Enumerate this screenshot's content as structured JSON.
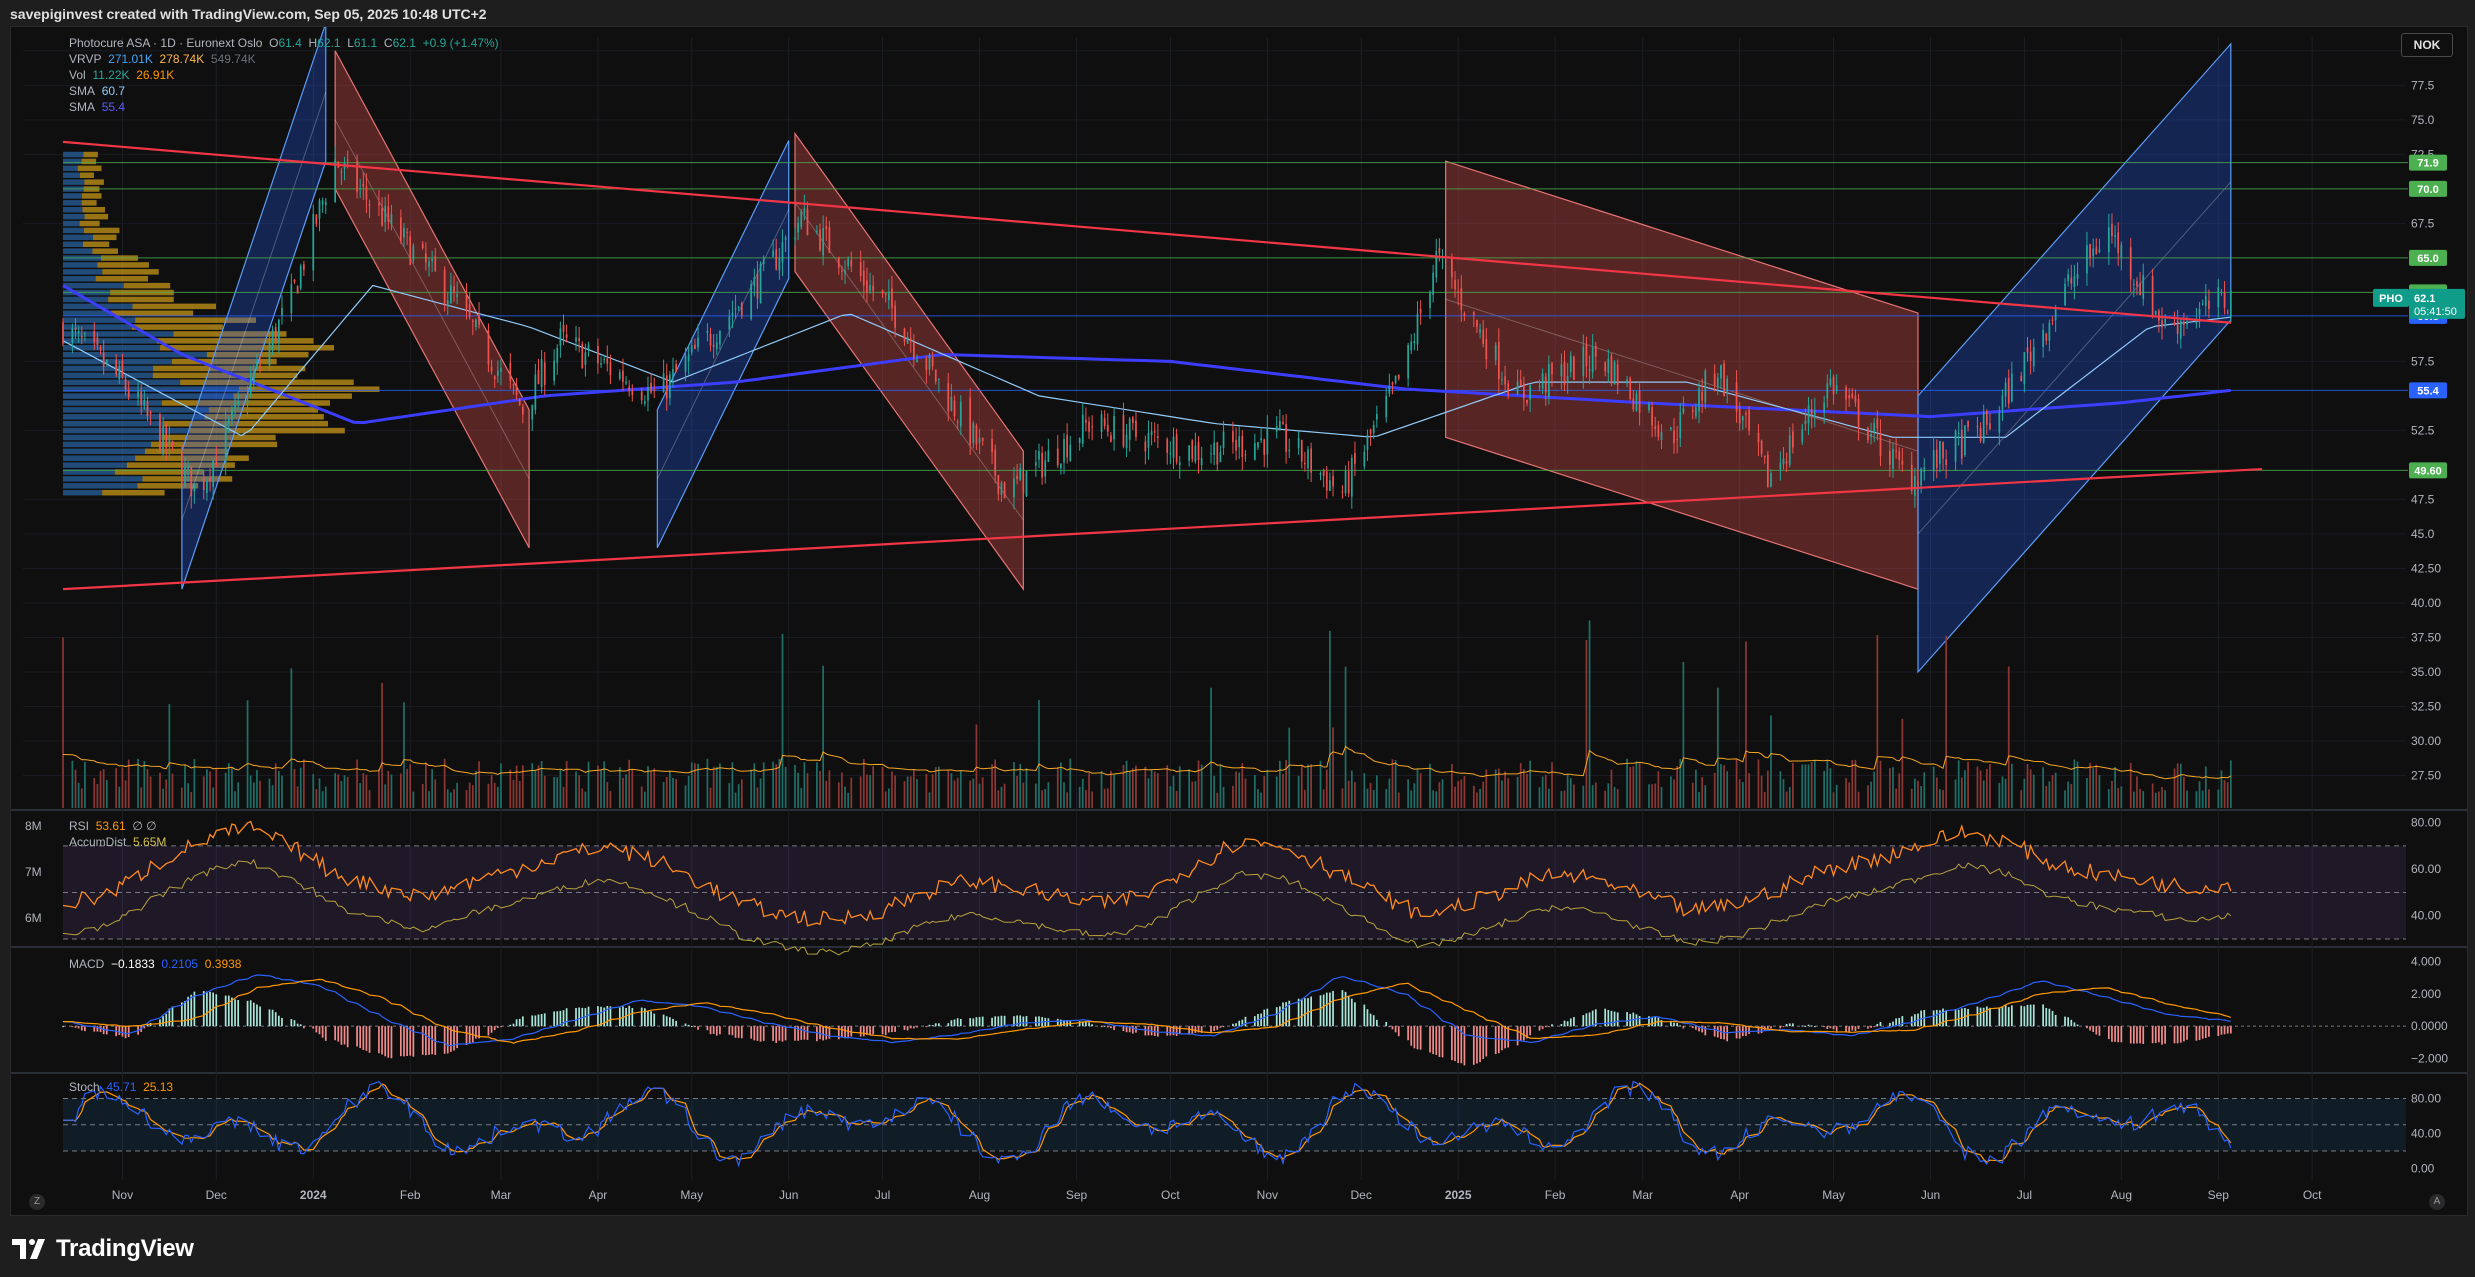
{
  "header": {
    "attribution": "savepiginvest created with TradingView.com, Sep 05, 2025 10:48 UTC+2"
  },
  "symbol": {
    "name": "Photocure ASA · 1D · Euronext Oslo",
    "open_label": "O",
    "open": "61.4",
    "high_label": "H",
    "high": "62.1",
    "low_label": "L",
    "low": "61.1",
    "close_label": "C",
    "close": "62.1",
    "change": "+0.9 (+1.47%)",
    "ticker": "PHO",
    "countdown": "05:41:50"
  },
  "indicators": {
    "vrvp": {
      "label": "VRVP",
      "v1": "271.01K",
      "v2": "278.74K",
      "v3": "549.74K"
    },
    "vol": {
      "label": "Vol",
      "v1": "11.22K",
      "v2": "26.91K"
    },
    "sma1": {
      "label": "SMA",
      "value": "60.7"
    },
    "sma2": {
      "label": "SMA",
      "value": "55.4"
    },
    "rsi": {
      "label": "RSI",
      "value": "53.61",
      "extra": "∅ ∅"
    },
    "accdist": {
      "label": "AccumDist",
      "value": "5.65M"
    },
    "macd": {
      "label": "MACD",
      "hist": "−0.1833",
      "macd": "0.2105",
      "signal": "0.3938"
    },
    "stoch": {
      "label": "Stoch",
      "k": "45.71",
      "d": "25.13"
    }
  },
  "currency": "NOK",
  "footer": {
    "brand": "TradingView",
    "corner_left": "Z",
    "corner_right": "A"
  },
  "colors": {
    "up": "#26a69a",
    "down": "#ef5350",
    "trend": "#f23645",
    "sma_fast": "#90caf9",
    "sma_slow": "#3d3dff",
    "level": "#4caf50",
    "blue_level": "#2962ff",
    "orange": "#ff9800",
    "volume_avg": "#f5a623",
    "stoch_k": "#2962ff",
    "stoch_d": "#ff9800",
    "rsi_band": "#7e57c2"
  },
  "chart_data": {
    "type": "candlestick",
    "title": "Photocure ASA · 1D · Euronext Oslo",
    "x_range": [
      "2023-10-13",
      "2025-10-31"
    ],
    "x_ticks": [
      {
        "date": "2023-11-01",
        "label": "Nov"
      },
      {
        "date": "2023-12-01",
        "label": "Dec"
      },
      {
        "date": "2024-01-01",
        "label": "2024"
      },
      {
        "date": "2024-02-01",
        "label": "Feb"
      },
      {
        "date": "2024-03-01",
        "label": "Mar"
      },
      {
        "date": "2024-04-01",
        "label": "Apr"
      },
      {
        "date": "2024-05-01",
        "label": "May"
      },
      {
        "date": "2024-06-01",
        "label": "Jun"
      },
      {
        "date": "2024-07-01",
        "label": "Jul"
      },
      {
        "date": "2024-08-01",
        "label": "Aug"
      },
      {
        "date": "2024-09-01",
        "label": "Sep"
      },
      {
        "date": "2024-10-01",
        "label": "Oct"
      },
      {
        "date": "2024-11-01",
        "label": "Nov"
      },
      {
        "date": "2024-12-01",
        "label": "Dec"
      },
      {
        "date": "2025-01-01",
        "label": "2025"
      },
      {
        "date": "2025-02-01",
        "label": "Feb"
      },
      {
        "date": "2025-03-01",
        "label": "Mar"
      },
      {
        "date": "2025-04-01",
        "label": "Apr"
      },
      {
        "date": "2025-05-01",
        "label": "May"
      },
      {
        "date": "2025-06-01",
        "label": "Jun"
      },
      {
        "date": "2025-07-01",
        "label": "Jul"
      },
      {
        "date": "2025-08-01",
        "label": "Aug"
      },
      {
        "date": "2025-09-01",
        "label": "Sep"
      },
      {
        "date": "2025-10-01",
        "label": "Oct"
      }
    ],
    "price_axis": {
      "ylim": [
        25.0,
        81.0
      ],
      "ticks": [
        "80.0",
        "77.5",
        "75.0",
        "72.5",
        "67.5",
        "57.5",
        "52.5",
        "47.5",
        "45.0",
        "42.50",
        "40.00",
        "37.50",
        "35.00",
        "32.50",
        "30.00",
        "27.50"
      ]
    },
    "price_path": [
      {
        "date": "2023-10-13",
        "price": 60
      },
      {
        "date": "2023-11-01",
        "price": 56
      },
      {
        "date": "2023-11-25",
        "price": 48
      },
      {
        "date": "2023-12-25",
        "price": 62
      },
      {
        "date": "2024-01-08",
        "price": 72
      },
      {
        "date": "2024-02-15",
        "price": 62
      },
      {
        "date": "2024-03-08",
        "price": 54
      },
      {
        "date": "2024-03-20",
        "price": 59
      },
      {
        "date": "2024-04-20",
        "price": 55
      },
      {
        "date": "2024-05-25",
        "price": 64
      },
      {
        "date": "2024-06-05",
        "price": 68
      },
      {
        "date": "2024-07-05",
        "price": 61
      },
      {
        "date": "2024-08-10",
        "price": 48
      },
      {
        "date": "2024-09-05",
        "price": 53
      },
      {
        "date": "2024-10-10",
        "price": 51
      },
      {
        "date": "2024-11-05",
        "price": 52
      },
      {
        "date": "2024-11-25",
        "price": 48
      },
      {
        "date": "2024-12-15",
        "price": 57
      },
      {
        "date": "2024-12-25",
        "price": 65
      },
      {
        "date": "2025-01-20",
        "price": 55
      },
      {
        "date": "2025-02-15",
        "price": 58
      },
      {
        "date": "2025-03-10",
        "price": 52
      },
      {
        "date": "2025-03-25",
        "price": 57
      },
      {
        "date": "2025-04-10",
        "price": 49
      },
      {
        "date": "2025-04-30",
        "price": 56
      },
      {
        "date": "2025-05-25",
        "price": 49
      },
      {
        "date": "2025-06-20",
        "price": 53
      },
      {
        "date": "2025-07-15",
        "price": 63
      },
      {
        "date": "2025-07-28",
        "price": 67
      },
      {
        "date": "2025-08-15",
        "price": 60
      },
      {
        "date": "2025-09-05",
        "price": 62.1
      }
    ],
    "horizontal_levels": [
      {
        "price": 71.9,
        "label": "71.9",
        "color": "#4caf50"
      },
      {
        "price": 70.0,
        "label": "70.0",
        "color": "#4caf50"
      },
      {
        "price": 65.0,
        "label": "65.0",
        "color": "#4caf50"
      },
      {
        "price": 62.5,
        "label": "62.5",
        "color": "#4caf50"
      },
      {
        "price": 60.8,
        "label": "60.8",
        "color": "#2962ff"
      },
      {
        "price": 55.4,
        "label": "55.4",
        "color": "#2962ff"
      },
      {
        "price": 49.6,
        "label": "49.60",
        "color": "#4caf50"
      }
    ],
    "trendlines": [
      {
        "from": {
          "date": "2023-10-13",
          "price": 73.4
        },
        "to": {
          "date": "2025-09-05",
          "price": 60.3
        }
      },
      {
        "from": {
          "date": "2023-10-13",
          "price": 41.0
        },
        "to": {
          "date": "2025-09-15",
          "price": 49.7
        }
      }
    ],
    "sma_fast": [
      {
        "date": "2023-10-13",
        "price": 59
      },
      {
        "date": "2023-12-10",
        "price": 52
      },
      {
        "date": "2024-01-20",
        "price": 63
      },
      {
        "date": "2024-03-10",
        "price": 60
      },
      {
        "date": "2024-04-25",
        "price": 56
      },
      {
        "date": "2024-06-20",
        "price": 61
      },
      {
        "date": "2024-08-20",
        "price": 55
      },
      {
        "date": "2024-10-15",
        "price": 53
      },
      {
        "date": "2024-12-05",
        "price": 52
      },
      {
        "date": "2025-01-25",
        "price": 56
      },
      {
        "date": "2025-03-15",
        "price": 56
      },
      {
        "date": "2025-05-20",
        "price": 52
      },
      {
        "date": "2025-06-25",
        "price": 52
      },
      {
        "date": "2025-08-10",
        "price": 60
      },
      {
        "date": "2025-09-05",
        "price": 60.7
      }
    ],
    "sma_slow": [
      {
        "date": "2023-10-13",
        "price": 63
      },
      {
        "date": "2023-11-20",
        "price": 58
      },
      {
        "date": "2024-01-15",
        "price": 53
      },
      {
        "date": "2024-03-15",
        "price": 55
      },
      {
        "date": "2024-05-15",
        "price": 56
      },
      {
        "date": "2024-07-20",
        "price": 58
      },
      {
        "date": "2024-10-01",
        "price": 57.5
      },
      {
        "date": "2024-12-15",
        "price": 55.5
      },
      {
        "date": "2025-03-01",
        "price": 54.5
      },
      {
        "date": "2025-06-01",
        "price": 53.5
      },
      {
        "date": "2025-08-01",
        "price": 54.5
      },
      {
        "date": "2025-09-05",
        "price": 55.4
      }
    ],
    "channels": [
      {
        "color": "#2962ff",
        "a": {
          "date": "2023-11-20",
          "price": 46
        },
        "b": {
          "date": "2024-01-05",
          "price": 77
        },
        "width": 5
      },
      {
        "color": "#ef5350",
        "a": {
          "date": "2024-01-08",
          "price": 75
        },
        "b": {
          "date": "2024-03-10",
          "price": 49
        },
        "width": 5
      },
      {
        "color": "#2962ff",
        "a": {
          "date": "2024-04-20",
          "price": 49
        },
        "b": {
          "date": "2024-06-01",
          "price": 68.5
        },
        "width": 5
      },
      {
        "color": "#ef5350",
        "a": {
          "date": "2024-06-03",
          "price": 69
        },
        "b": {
          "date": "2024-08-15",
          "price": 46
        },
        "width": 5
      },
      {
        "color": "#ef5350",
        "a": {
          "date": "2024-12-28",
          "price": 62
        },
        "b": {
          "date": "2025-05-28",
          "price": 51
        },
        "width": 10
      },
      {
        "color": "#2962ff",
        "a": {
          "date": "2025-05-28",
          "price": 45
        },
        "b": {
          "date": "2025-09-05",
          "price": 70.5
        },
        "width": 10
      }
    ],
    "volume_profile": {
      "price_range": [
        47.5,
        72.5
      ],
      "peak_price": 55,
      "peak_volume": "549.74K"
    },
    "rsi": {
      "ylim": [
        30,
        82
      ],
      "ticks": [
        "80.00",
        "60.00",
        "40.00"
      ],
      "bands": [
        70,
        30
      ],
      "last": 53.61,
      "path": [
        45,
        50,
        62,
        72,
        78,
        70,
        58,
        52,
        48,
        55,
        60,
        66,
        70,
        64,
        55,
        45,
        40,
        38,
        42,
        50,
        55,
        52,
        48,
        45,
        50,
        62,
        72,
        70,
        60,
        50,
        40,
        45,
        52,
        58,
        55,
        48,
        42,
        45,
        52,
        60,
        64,
        70,
        76,
        72,
        62,
        58,
        55,
        52,
        54
      ]
    },
    "accum_dist": {
      "ticks": [
        "8M",
        "7M",
        "6M"
      ],
      "last": "5.65M"
    },
    "macd": {
      "ylim": [
        -2.4,
        4.4
      ],
      "ticks": [
        "4.000",
        "2.000",
        "0.0000",
        "−2.000"
      ],
      "macd": 0.2105,
      "signal": 0.3938,
      "hist": -0.1833,
      "path": [
        0.3,
        -0.5,
        1.8,
        3.2,
        2.5,
        0.5,
        -1.2,
        -0.8,
        0.4,
        1.6,
        1.2,
        0.2,
        -0.6,
        -1.0,
        -0.5,
        0.2,
        0.4,
        -0.3,
        -0.6,
        0.8,
        3.1,
        2.0,
        -0.6,
        -1.0,
        0.1,
        0.6,
        -0.4,
        -0.2,
        -0.6,
        0.3,
        1.5,
        2.8,
        1.8,
        0.7,
        0.3
      ]
    },
    "stoch": {
      "ylim": [
        -4,
        100
      ],
      "ticks": [
        "80.00",
        "40.00",
        "0.00"
      ],
      "bands": [
        80,
        20
      ],
      "k": 45.71,
      "d": 25.13
    }
  }
}
